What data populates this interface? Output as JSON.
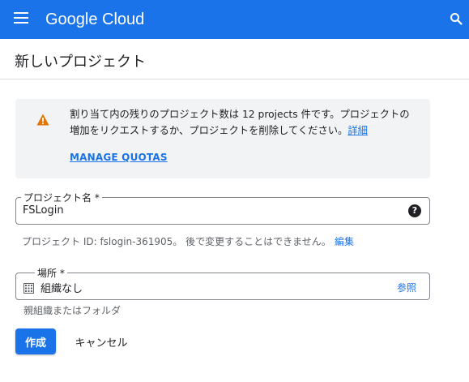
{
  "header": {
    "logo_text": "Google Cloud",
    "brand_color": "#1a73e8",
    "menu_icon": "hamburger-menu-icon",
    "search_icon": "search-icon"
  },
  "page": {
    "title": "新しいプロジェクト"
  },
  "quota_notice": {
    "icon": "warning-icon",
    "icon_color": "#e37400",
    "message": "割り当て内の残りのプロジェクト数は 12 projects 件です。プロジェクトの増加をリクエストするか、プロジェクトを削除してください。",
    "detail_link": "詳細",
    "manage_link": "MANAGE QUOTAS"
  },
  "project_name": {
    "label": "プロジェクト名 *",
    "value": "FSLogin",
    "help_icon": "help-icon"
  },
  "project_id": {
    "text": "プロジェクト ID: fslogin-361905。 後で変更することはできません。",
    "edit_link": "編集"
  },
  "location": {
    "label": "場所 *",
    "value": "組織なし",
    "icon": "building-icon",
    "browse_link": "参照",
    "hint": "親組織またはフォルダ"
  },
  "actions": {
    "create_label": "作成",
    "cancel_label": "キャンセル"
  }
}
